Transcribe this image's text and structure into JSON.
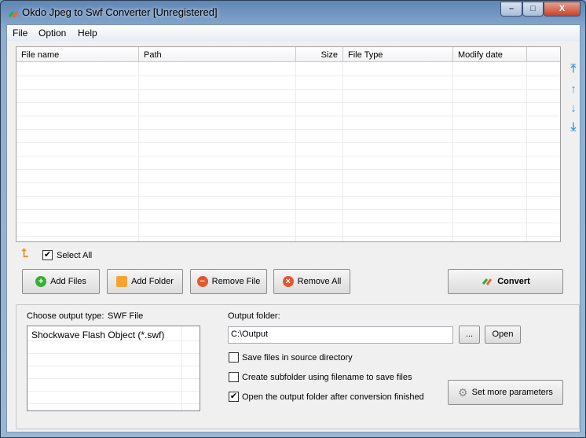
{
  "window": {
    "title": "Okdo Jpeg to Swf Converter [Unregistered]",
    "minimize": "–",
    "maximize": "□",
    "close": "X"
  },
  "menu": [
    "File",
    "Option",
    "Help"
  ],
  "list": {
    "columns": [
      "File name",
      "Path",
      "Size",
      "File Type",
      "Modify date"
    ],
    "rows": []
  },
  "select_all": {
    "label": "Select All",
    "checked": true
  },
  "buttons": {
    "add_files": "Add Files",
    "add_folder": "Add Folder",
    "remove_file": "Remove File",
    "remove_all": "Remove All",
    "convert": "Convert"
  },
  "output": {
    "type_label": "Choose output type:",
    "type_value": "SWF File",
    "types": [
      "Shockwave Flash Object (*.swf)"
    ],
    "folder_label": "Output folder:",
    "folder_value": "C:\\Output",
    "browse": "...",
    "open": "Open",
    "more_params": "Set more parameters"
  },
  "options": [
    {
      "label": "Save files in source directory",
      "checked": false
    },
    {
      "label": "Create subfolder using filename to save files",
      "checked": false
    },
    {
      "label": "Open the output folder after conversion finished",
      "checked": true
    }
  ]
}
